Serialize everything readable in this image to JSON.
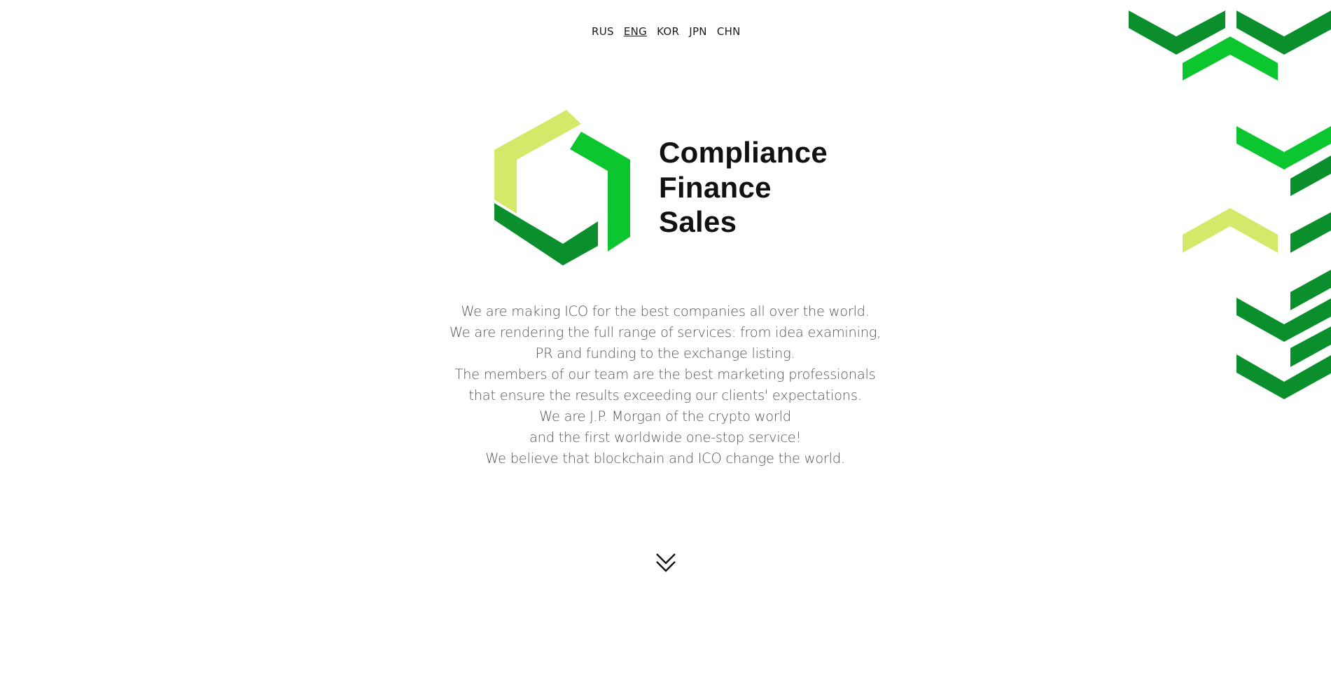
{
  "languages": [
    {
      "label": "RUS",
      "active": false
    },
    {
      "label": "ENG",
      "active": true
    },
    {
      "label": "KOR",
      "active": false
    },
    {
      "label": "JPN",
      "active": false
    },
    {
      "label": "CHN",
      "active": false
    }
  ],
  "brand": {
    "line1": "Compliance",
    "line2": "Finance",
    "line3": "Sales"
  },
  "intro": {
    "lines": [
      "We are making ICO for the best companies all over the world.",
      "We are rendering the full range of services: from idea examining,",
      "PR and funding to the exchange listing.",
      "The members of our team are the best marketing professionals",
      "that ensure the results exceeding our clients' expectations.",
      "We are J.P. Morgan of the crypto world",
      "and the first worldwide one-stop service!",
      "We believe that blockchain and ICO change the world."
    ]
  },
  "icons": {
    "scroll": "double-chevron-down-icon",
    "logo": "hexagon-logo-icon"
  },
  "colors": {
    "dark_green": "#0a8f2c",
    "bright_green": "#0cc62f",
    "lime": "#d4e96a",
    "text_dark": "#111111",
    "text_body": "#555555"
  }
}
